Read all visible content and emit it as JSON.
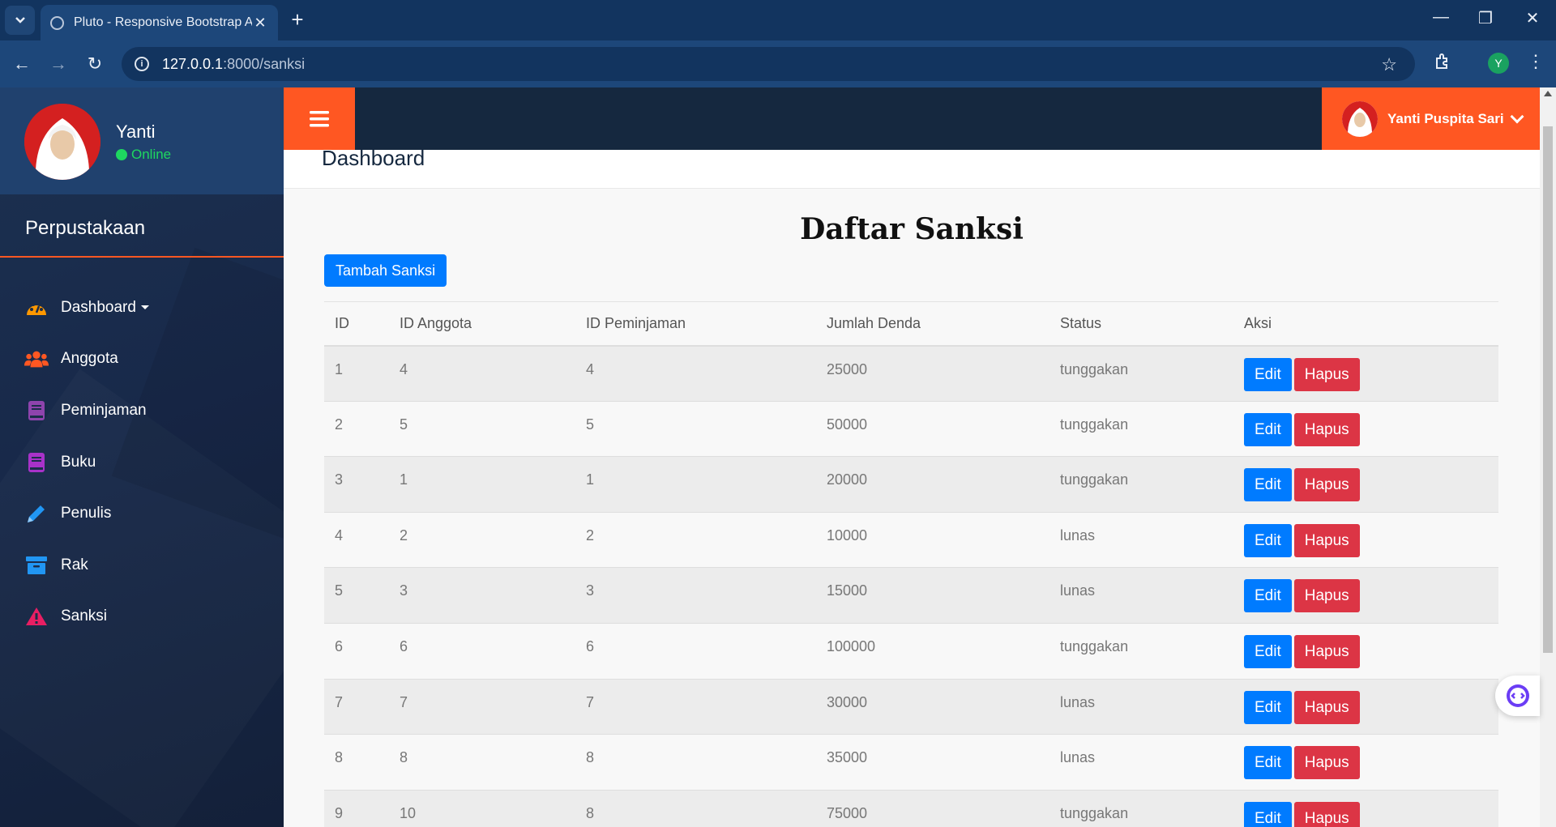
{
  "browser": {
    "tab_title": "Pluto - Responsive Bootstrap Ac",
    "tab_close": "✕",
    "new_tab": "+",
    "url_host": "127.0.0.1",
    "url_path": ":8000/sanksi",
    "profile_initial": "Y",
    "window_controls": {
      "minimize": "—",
      "restore": "❐",
      "close": "✕"
    }
  },
  "sidebar": {
    "user_name": "Yanti",
    "status": "Online",
    "brand": "Perpustakaan",
    "items": [
      {
        "label": "Dashboard",
        "icon": "tachometer-icon",
        "color": "#ff9800",
        "dropdown": true
      },
      {
        "label": "Anggota",
        "icon": "users-icon",
        "color": "#ff5722"
      },
      {
        "label": "Peminjaman",
        "icon": "book-icon",
        "color": "#8e44ad"
      },
      {
        "label": "Buku",
        "icon": "book-icon",
        "color": "#a832c9"
      },
      {
        "label": "Penulis",
        "icon": "pencil-icon",
        "color": "#2196f3"
      },
      {
        "label": "Rak",
        "icon": "archive-icon",
        "color": "#2196f3"
      },
      {
        "label": "Sanksi",
        "icon": "warning-icon",
        "color": "#e91e63"
      }
    ]
  },
  "header": {
    "user_name": "Yanti Puspita Sari",
    "accent_color": "#ff5722"
  },
  "page": {
    "title": "Dashboard",
    "list_title": "Daftar Sanksi",
    "add_button": "Tambah Sanksi"
  },
  "table": {
    "columns": [
      "ID",
      "ID Anggota",
      "ID Peminjaman",
      "Jumlah Denda",
      "Status",
      "Aksi"
    ],
    "edit_label": "Edit",
    "delete_label": "Hapus",
    "rows": [
      {
        "id": "1",
        "id_anggota": "4",
        "id_peminjaman": "4",
        "jumlah_denda": "25000",
        "status": "tunggakan"
      },
      {
        "id": "2",
        "id_anggota": "5",
        "id_peminjaman": "5",
        "jumlah_denda": "50000",
        "status": "tunggakan"
      },
      {
        "id": "3",
        "id_anggota": "1",
        "id_peminjaman": "1",
        "jumlah_denda": "20000",
        "status": "tunggakan"
      },
      {
        "id": "4",
        "id_anggota": "2",
        "id_peminjaman": "2",
        "jumlah_denda": "10000",
        "status": "lunas"
      },
      {
        "id": "5",
        "id_anggota": "3",
        "id_peminjaman": "3",
        "jumlah_denda": "15000",
        "status": "lunas"
      },
      {
        "id": "6",
        "id_anggota": "6",
        "id_peminjaman": "6",
        "jumlah_denda": "100000",
        "status": "tunggakan"
      },
      {
        "id": "7",
        "id_anggota": "7",
        "id_peminjaman": "7",
        "jumlah_denda": "30000",
        "status": "lunas"
      },
      {
        "id": "8",
        "id_anggota": "8",
        "id_peminjaman": "8",
        "jumlah_denda": "35000",
        "status": "lunas"
      },
      {
        "id": "9",
        "id_anggota": "10",
        "id_peminjaman": "8",
        "jumlah_denda": "75000",
        "status": "tunggakan"
      }
    ]
  }
}
